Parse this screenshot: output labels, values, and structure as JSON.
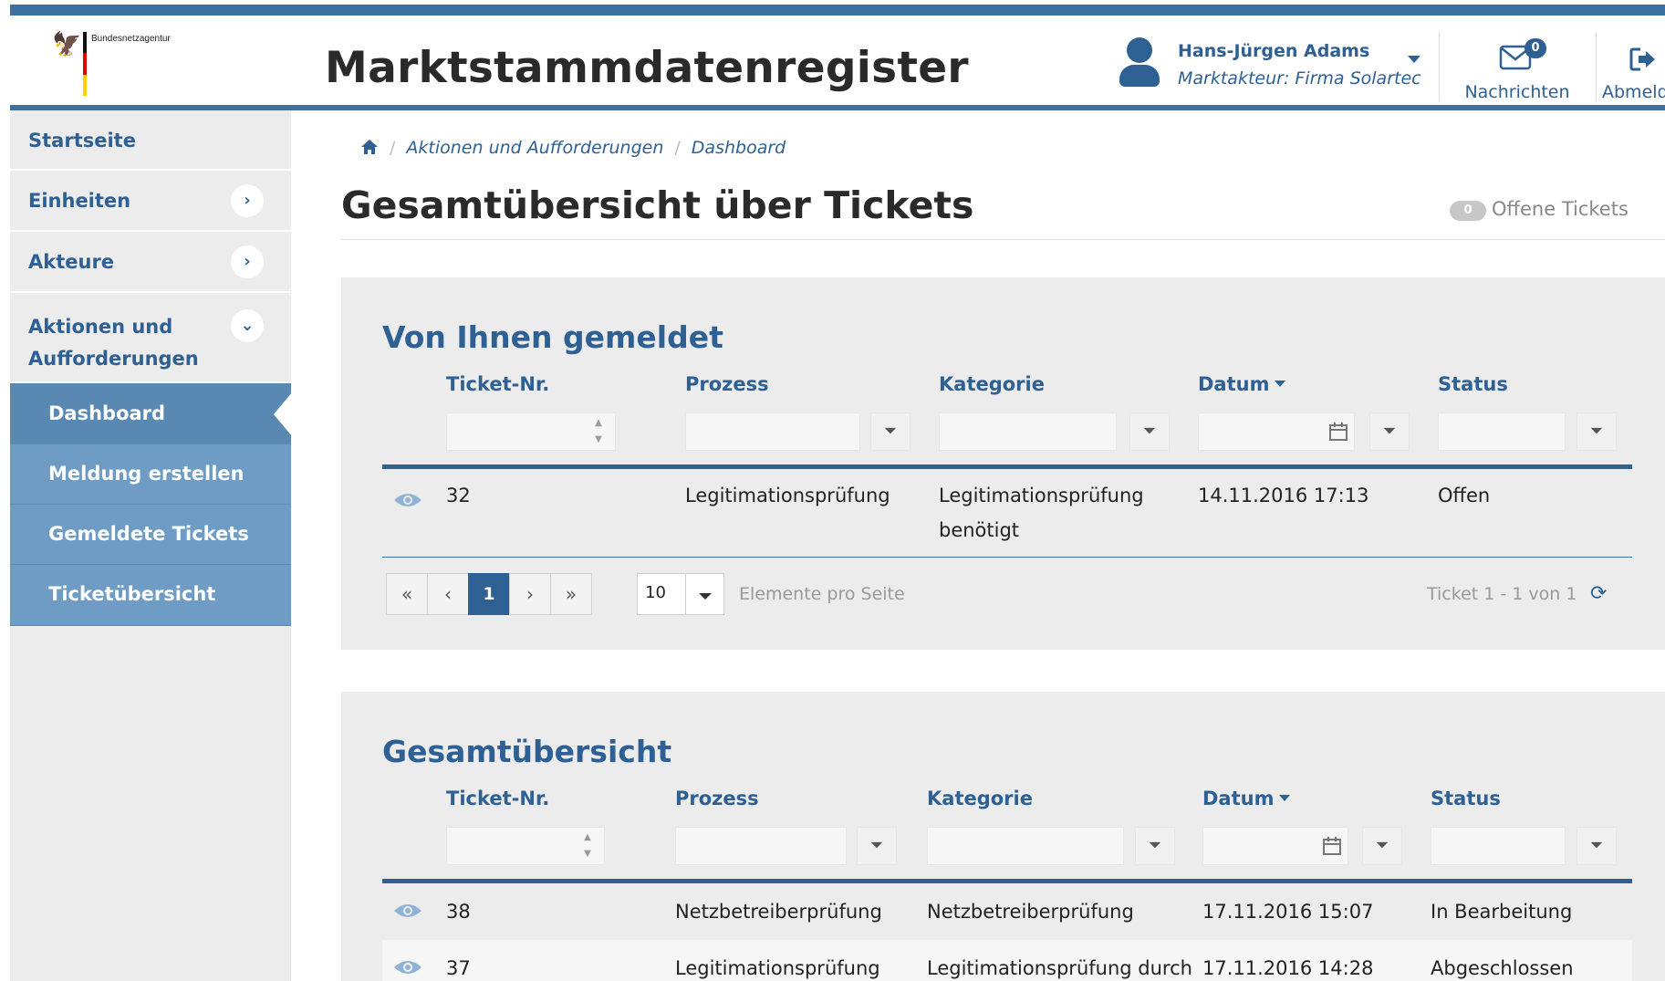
{
  "header": {
    "agency": "Bundesnetzagentur",
    "app_title": "Marktstammdatenregister",
    "user": {
      "name": "Hans-Jürgen Adams",
      "role": "Marktakteur: Firma Solartec"
    },
    "messages": {
      "label": "Nachrichten",
      "count": "0"
    },
    "logout": {
      "label": "Abmelden"
    }
  },
  "sidebar": {
    "items": [
      {
        "label": "Startseite"
      },
      {
        "label": "Einheiten",
        "chevron": ">"
      },
      {
        "label": "Akteure",
        "chevron": ">"
      },
      {
        "label": "Aktionen und Aufforderungen",
        "chevron": "v"
      }
    ],
    "subitems": [
      {
        "label": "Dashboard",
        "active": true
      },
      {
        "label": "Meldung erstellen"
      },
      {
        "label": "Gemeldete Tickets"
      },
      {
        "label": "Ticketübersicht"
      }
    ]
  },
  "breadcrumb": {
    "home_icon": "home-icon",
    "items": [
      "Aktionen und Aufforderungen",
      "Dashboard"
    ]
  },
  "main": {
    "page_title": "Gesamtübersicht über Tickets",
    "open_tickets": {
      "count": "0",
      "label": "Offene Tickets"
    }
  },
  "panels": {
    "reported": {
      "title": "Von Ihnen gemeldet",
      "columns": [
        "Ticket-Nr.",
        "Prozess",
        "Kategorie",
        "Datum",
        "Status"
      ],
      "rows": [
        {
          "ticket": "32",
          "prozess": "Legitimationsprüfung",
          "kategorie": "Legitimationsprüfung benötigt",
          "datum": "14.11.2016 17:13",
          "status": "Offen"
        }
      ],
      "pager": {
        "first": "«",
        "prev": "‹",
        "page": "1",
        "next": "›",
        "last": "»",
        "page_size": "10",
        "page_size_label": "Elemente pro Seite",
        "range_text": "Ticket 1 - 1 von 1"
      }
    },
    "overview": {
      "title": "Gesamtübersicht",
      "columns": [
        "Ticket-Nr.",
        "Prozess",
        "Kategorie",
        "Datum",
        "Status"
      ],
      "rows": [
        {
          "ticket": "38",
          "prozess": "Netzbetreiberprüfung",
          "kategorie": "Netzbetreiberprüfung",
          "datum": "17.11.2016 15:07",
          "status": "In Bearbeitung"
        },
        {
          "ticket": "37",
          "prozess": "Legitimationsprüfung",
          "kategorie": "Legitimationsprüfung durch",
          "datum": "17.11.2016 14:28",
          "status": "Abgeschlossen"
        }
      ]
    }
  },
  "colors": {
    "brand_blue": "#2e6094",
    "topbar_blue": "#3b71a0",
    "sidebar_sub": "#6e9cc4",
    "panel_bg": "#ececec"
  }
}
